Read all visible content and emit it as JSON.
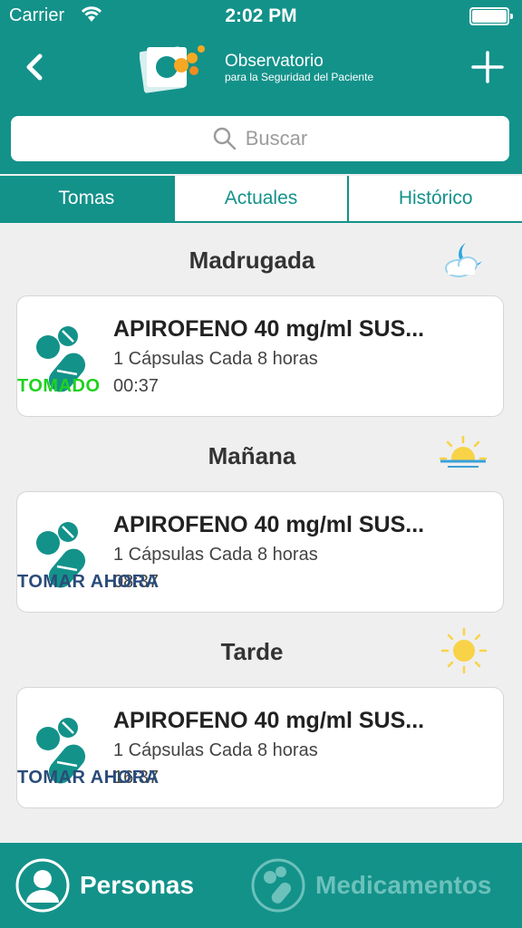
{
  "status_bar": {
    "carrier": "Carrier",
    "time": "2:02 PM"
  },
  "header": {
    "brand_title": "Observatorio",
    "brand_subtitle": "para la Seguridad del Paciente"
  },
  "search": {
    "placeholder": "Buscar"
  },
  "tabs": [
    {
      "label": "Tomas",
      "active": true
    },
    {
      "label": "Actuales",
      "active": false
    },
    {
      "label": "Histórico",
      "active": false
    }
  ],
  "sections": [
    {
      "title": "Madrugada",
      "icon": "moon-cloud-icon",
      "item": {
        "name": "APIROFENO 40 mg/ml SUS...",
        "dose": "1 Cápsulas Cada 8 horas",
        "time": "00:37",
        "status": "TOMADO"
      }
    },
    {
      "title": "Mañana",
      "icon": "sunrise-icon",
      "item": {
        "name": "APIROFENO 40 mg/ml SUS...",
        "dose": "1 Cápsulas Cada 8 horas",
        "time": "08:37",
        "status": "TOMAR AHORA"
      }
    },
    {
      "title": "Tarde",
      "icon": "sun-icon",
      "item": {
        "name": "APIROFENO 40 mg/ml SUS...",
        "dose": "1 Cápsulas Cada 8 horas",
        "time": "16:37",
        "status": "TOMAR AHORA"
      }
    }
  ],
  "bottom_tabs": [
    {
      "label": "Personas",
      "active": true
    },
    {
      "label": "Medicamentos",
      "active": false
    }
  ],
  "colors": {
    "primary": "#13928a",
    "taken": "#1fd21f",
    "take_now": "#2a4c7a"
  }
}
